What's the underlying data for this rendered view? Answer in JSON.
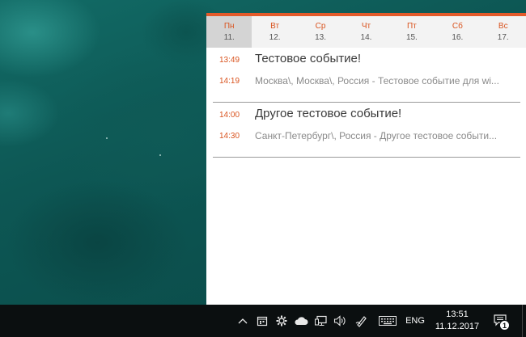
{
  "calendar": {
    "days": [
      {
        "name": "Пн",
        "date": "11."
      },
      {
        "name": "Вт",
        "date": "12."
      },
      {
        "name": "Ср",
        "date": "13."
      },
      {
        "name": "Чт",
        "date": "14."
      },
      {
        "name": "Пт",
        "date": "15."
      },
      {
        "name": "Сб",
        "date": "16."
      },
      {
        "name": "Вс",
        "date": "17."
      }
    ],
    "accent_color": "#e35a2a"
  },
  "events": [
    {
      "start": "13:49",
      "end": "14:19",
      "title": "Тестовое событие!",
      "subtitle": "Москва\\, Москва\\, Россия - Тестовое событие для wi..."
    },
    {
      "start": "14:00",
      "end": "14:30",
      "title": "Другое тестовое событие!",
      "subtitle": "Санкт-Петербург\\, Россия - Другое тестовое событи..."
    }
  ],
  "taskbar": {
    "language": "ENG",
    "time": "13:51",
    "date": "11.12.2017",
    "notification_count": "1",
    "icons": [
      "chevron-up-icon",
      "calendar-icon",
      "gear-icon",
      "cloud-icon",
      "network-icon",
      "volume-icon",
      "pen-icon",
      "keyboard-icon",
      "action-center-icon"
    ]
  }
}
